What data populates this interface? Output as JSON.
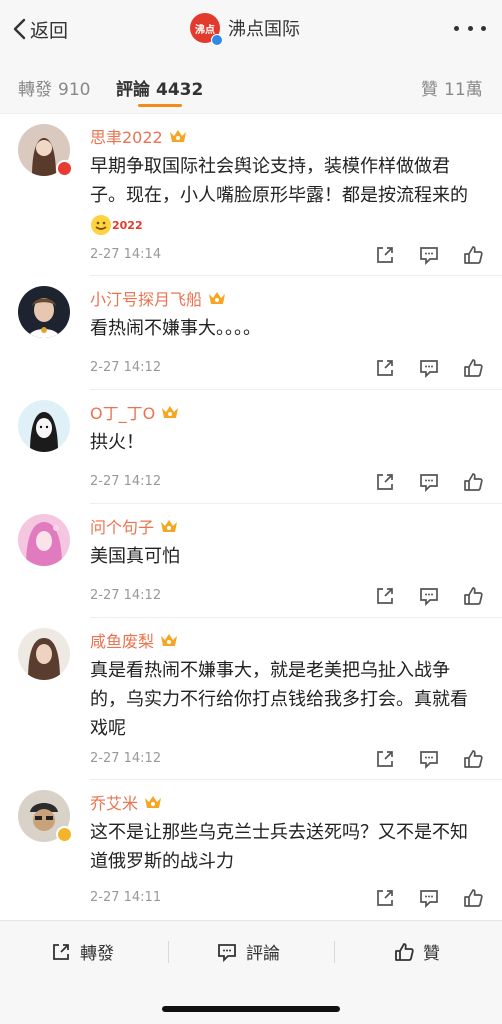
{
  "header": {
    "back_label": "返回",
    "title": "沸点国际",
    "logo_text": "沸点",
    "icons": [
      "chevron-left-icon",
      "more-dots-icon"
    ]
  },
  "tabs": [
    {
      "label": "轉發",
      "count": "910"
    },
    {
      "label": "評論",
      "count": "4432"
    },
    {
      "label": "贊",
      "count": "11萬"
    }
  ],
  "comments": [
    {
      "user": "思聿2022",
      "text": "早期争取国际社会舆论支持，装模作样做做君子。现在，小人嘴脸原形毕露！都是按流程来的",
      "emoji_text": "2022",
      "time": "2-27 14:14"
    },
    {
      "user": "小汀号探月飞船",
      "text": "看热闹不嫌事大。。。。",
      "time": "2-27 14:12"
    },
    {
      "user": "O丁_丁O",
      "text": "拱火！",
      "time": "2-27 14:12"
    },
    {
      "user": "问个句子",
      "text": "美国真可怕",
      "time": "2-27 14:12"
    },
    {
      "user": "咸鱼废梨",
      "text": "真是看热闹不嫌事大，就是老美把乌扯入战争的，乌实力不行给你打点钱给我多打会。真就看戏呢",
      "time": "2-27 14:12"
    },
    {
      "user": "乔艾米",
      "text": "这不是让那些乌克兰士兵去送死吗？又不是不知道俄罗斯的战斗力",
      "time": "2-27 14:11"
    }
  ],
  "bottom_bar": {
    "repost_label": "轉發",
    "comment_label": "評論",
    "like_label": "贊"
  },
  "colors": {
    "accent": "#f28a1c",
    "username": "#eb7350",
    "brand": "#e23b2e"
  }
}
